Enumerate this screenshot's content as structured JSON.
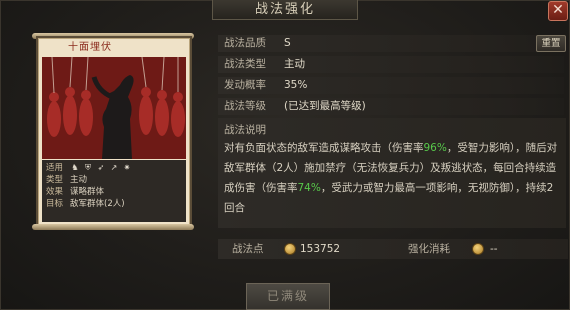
{
  "window": {
    "title": "战法强化",
    "close_glyph": "✕"
  },
  "card": {
    "name": "十面埋伏",
    "info": [
      {
        "key": "适用",
        "value": ""
      },
      {
        "key": "类型",
        "value": "主动"
      },
      {
        "key": "效果",
        "value": "谋略群体"
      },
      {
        "key": "目标",
        "value": "敌军群体(2人)"
      }
    ],
    "troop_icons": [
      "cavalry-icon",
      "shield-icon",
      "bow-icon",
      "spear-icon",
      "vehicle-icon"
    ]
  },
  "stats": {
    "grade_label": "战法品质",
    "grade_value": "S",
    "type_label": "战法类型",
    "type_value": "主动",
    "rate_label": "发动概率",
    "rate_value": "35%",
    "level_label": "战法等级",
    "level_value": "(已达到最高等级)",
    "reset_label": "重置"
  },
  "description": {
    "label": "战法说明",
    "segments": [
      {
        "text": "对有负面状态的敌军造成谋略攻击（伤害率",
        "hl": false
      },
      {
        "text": "96%",
        "hl": true
      },
      {
        "text": "，受智力影响），随后对敌军群体（2人）施加禁疗（无法恢复兵力）及叛逃状态，每回合持续造成伤害（伤害率",
        "hl": false
      },
      {
        "text": "74%",
        "hl": true
      },
      {
        "text": "，受武力或智力最高一项影响，无视防御），持续2回合",
        "hl": false
      }
    ],
    "highlight_color": "#58c84b"
  },
  "points": {
    "label": "战法点",
    "value": "153752",
    "cost_label": "强化消耗",
    "cost_value": "--"
  },
  "footer": {
    "max_button_label": "已满级"
  }
}
